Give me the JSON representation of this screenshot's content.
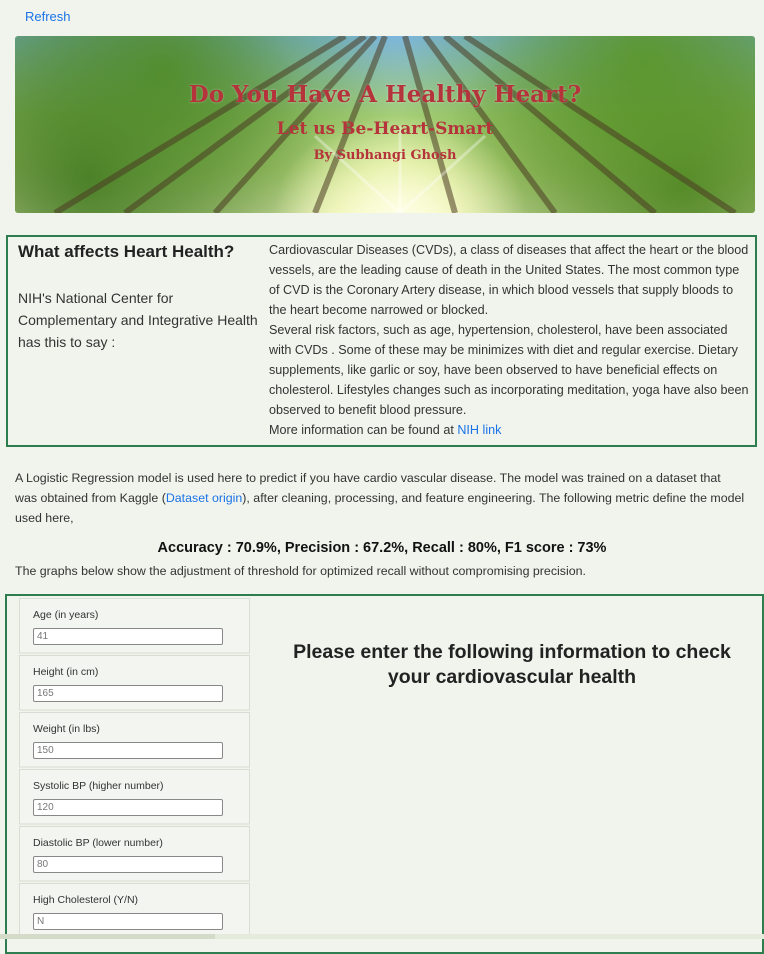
{
  "top": {
    "refresh_label": "Refresh"
  },
  "banner": {
    "title": "Do You Have A Healthy Heart?",
    "subtitle": "Let us Be-Heart-Smart",
    "byline": "By Subhangi Ghosh"
  },
  "info": {
    "heading": "What affects Heart Health?",
    "nih_intro": "NIH's National Center for Complementary and Integrative Health has this to say :",
    "paragraph_1": "Cardiovascular Diseases (CVDs), a class of diseases that affect the heart or the blood vessels, are the leading cause of death in the United States. The most common type of CVD is the Coronary Artery disease, in which blood vessels that supply bloods to the heart become narrowed or blocked.",
    "paragraph_2": "Several risk factors, such as age, hypertension, cholesterol, have been associated with CVDs . Some of these may be minimizes with diet and regular exercise. Dietary supplements, like garlic or soy, have been observed to have beneficial effects on cholesterol. Lifestyles changes such as incorporating meditation, yoga have also been observed to benefit blood pressure.",
    "more_prefix": "More information can be found at ",
    "nih_link": "NIH link"
  },
  "model": {
    "text_before_link": "A Logistic Regression model is used here to predict if you have cardio vascular disease. The model was trained on a dataset that was obtained from Kaggle (",
    "dataset_link": "Dataset origin",
    "text_after_link": "), after cleaning, processing, and feature engineering. The following metric define the model used here,",
    "metrics": "Accuracy : 70.9%, Precision : 67.2%, Recall : 80%, F1 score : 73%",
    "graphs_note": "The graphs below show the adjustment of threshold for optimized recall without compromising precision."
  },
  "form": {
    "fields": [
      {
        "label": "Age (in years)",
        "value": "41"
      },
      {
        "label": "Height (in cm)",
        "value": "165"
      },
      {
        "label": "Weight (in lbs)",
        "value": "150"
      },
      {
        "label": "Systolic BP (higher number)",
        "value": "120"
      },
      {
        "label": "Diastolic BP (lower number)",
        "value": "80"
      },
      {
        "label": "High Cholesterol (Y/N)",
        "value": "N"
      }
    ],
    "prompt": "Please enter the following information to check your cardiovascular health"
  }
}
